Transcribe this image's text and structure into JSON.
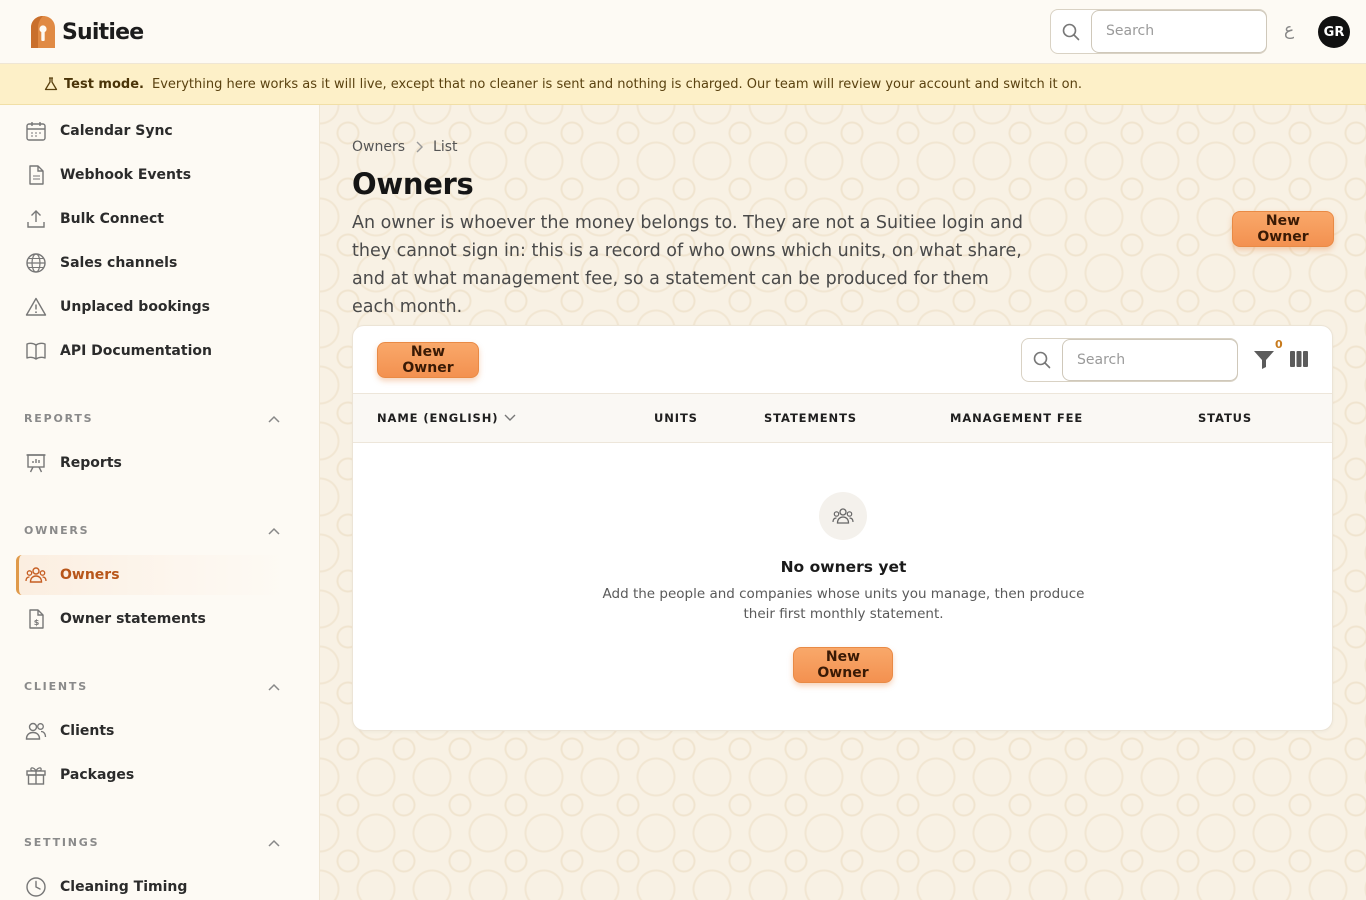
{
  "app": {
    "name": "Suitiee"
  },
  "topbar": {
    "search_placeholder": "Search",
    "lang_toggle": "ع",
    "avatar_initials": "GR"
  },
  "banner": {
    "title": "Test mode.",
    "message": "Everything here works as it will live, except that no cleaner is sent and nothing is charged. Our team will review your account and switch it on."
  },
  "sidebar": {
    "items_top": [
      {
        "label": "Calendar Sync",
        "icon": "calendar-icon"
      },
      {
        "label": "Webhook Events",
        "icon": "document-icon"
      },
      {
        "label": "Bulk Connect",
        "icon": "upload-icon"
      },
      {
        "label": "Sales channels",
        "icon": "globe-icon"
      },
      {
        "label": "Unplaced bookings",
        "icon": "warning-icon"
      },
      {
        "label": "API Documentation",
        "icon": "book-icon"
      }
    ],
    "sections": {
      "reports": {
        "label": "REPORTS",
        "items": [
          {
            "label": "Reports",
            "icon": "presentation-chart-icon"
          }
        ]
      },
      "owners": {
        "label": "OWNERS",
        "items": [
          {
            "label": "Owners",
            "icon": "users-group-icon",
            "active": true
          },
          {
            "label": "Owner statements",
            "icon": "invoice-icon"
          }
        ]
      },
      "clients": {
        "label": "CLIENTS",
        "items": [
          {
            "label": "Clients",
            "icon": "users-icon"
          },
          {
            "label": "Packages",
            "icon": "gift-icon"
          }
        ]
      },
      "settings": {
        "label": "SETTINGS",
        "items": [
          {
            "label": "Cleaning Timing",
            "icon": "clock-icon"
          }
        ]
      }
    }
  },
  "main": {
    "breadcrumb": {
      "root": "Owners",
      "current": "List"
    },
    "title": "Owners",
    "description": "An owner is whoever the money belongs to. They are not a Suitiee login and they cannot sign in: this is a record of who owns which units, on what share, and at what management fee, so a statement can be produced for them each month.",
    "new_owner_label": "New Owner"
  },
  "table": {
    "new_owner_label": "New Owner",
    "search_placeholder": "Search",
    "filter_count": "0",
    "columns": [
      "NAME (ENGLISH)",
      "UNITS",
      "STATEMENTS",
      "MANAGEMENT FEE",
      "STATUS"
    ],
    "rows": [],
    "empty": {
      "title": "No owners yet",
      "description": "Add the people and companies whose units you manage, then produce their first monthly statement.",
      "button_label": "New Owner"
    }
  },
  "colors": {
    "accent": "#f39150",
    "accent_text": "#b8561a",
    "banner_bg": "#fdf0c8",
    "page_bg": "#f8f1e4"
  }
}
